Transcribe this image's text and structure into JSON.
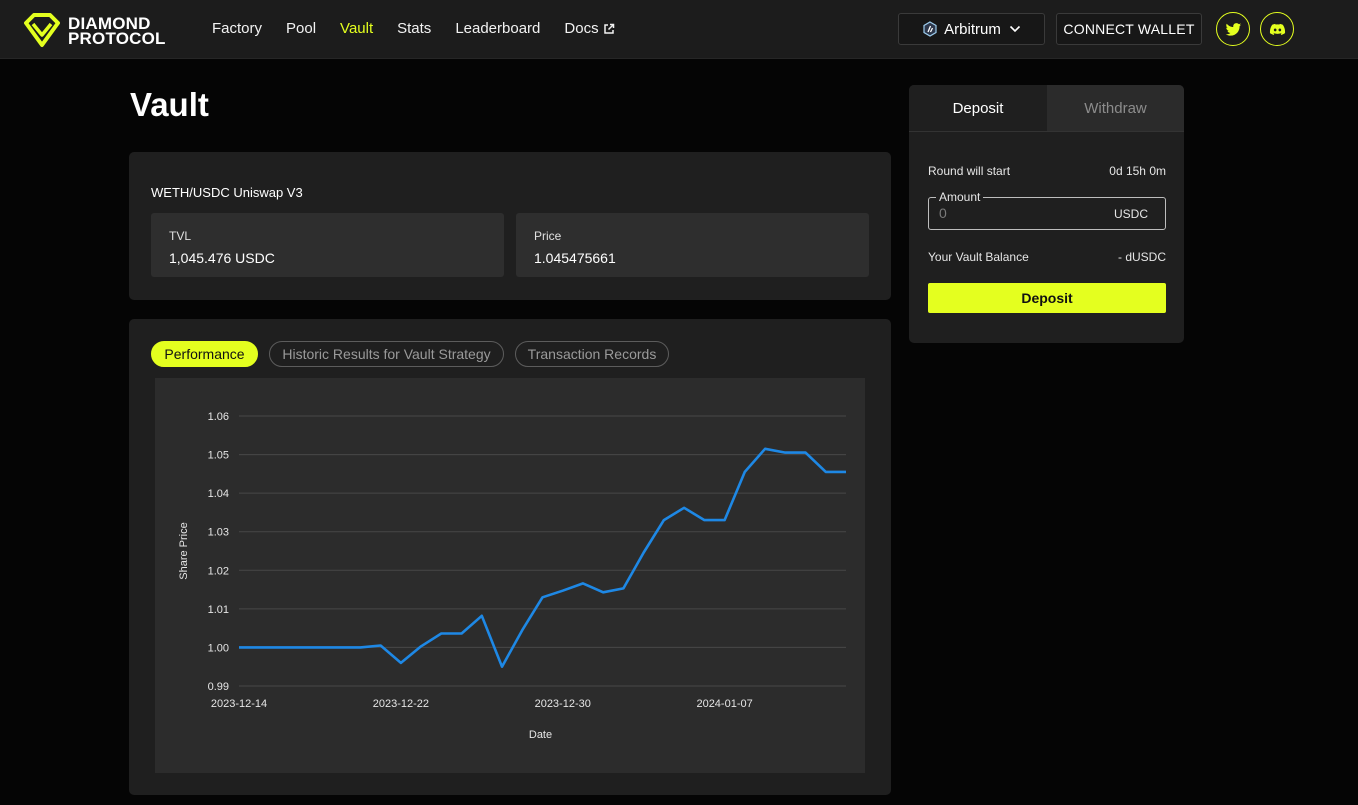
{
  "brand": {
    "line1": "DIAMOND",
    "line2": "PROTOCOL",
    "accent": "#e4ff1f"
  },
  "nav": {
    "links": [
      {
        "label": "Factory",
        "active": false
      },
      {
        "label": "Pool",
        "active": false
      },
      {
        "label": "Vault",
        "active": true
      },
      {
        "label": "Stats",
        "active": false
      },
      {
        "label": "Leaderboard",
        "active": false
      },
      {
        "label": "Docs",
        "active": false,
        "icon": "external-link-icon"
      }
    ],
    "network": "Arbitrum",
    "connect_label": "CONNECT WALLET",
    "socials": [
      "twitter-icon",
      "discord-icon"
    ]
  },
  "page": {
    "title": "Vault"
  },
  "vault": {
    "pair": "WETH/USDC Uniswap V3",
    "tvl_label": "TVL",
    "tvl_value": "1,045.476 USDC",
    "price_label": "Price",
    "price_value": "1.045475661"
  },
  "tabs": [
    {
      "label": "Performance",
      "active": true
    },
    {
      "label": "Historic Results for Vault Strategy",
      "active": false
    },
    {
      "label": "Transaction Records",
      "active": false
    }
  ],
  "side": {
    "tab_deposit": "Deposit",
    "tab_withdraw": "Withdraw",
    "round_label": "Round will start",
    "round_value": "0d 15h 0m",
    "amount_label": "Amount",
    "amount_placeholder": "0",
    "amount_unit": "USDC",
    "balance_label": "Your Vault Balance",
    "balance_value": "- dUSDC",
    "deposit_button": "Deposit"
  },
  "chart_data": {
    "type": "line",
    "xlabel": "Date",
    "ylabel": "Share Price",
    "ylim": [
      0.99,
      1.06
    ],
    "y_ticks": [
      "0.99",
      "1.00",
      "1.01",
      "1.02",
      "1.03",
      "1.04",
      "1.05",
      "1.06"
    ],
    "x_ticks": [
      "2023-12-14",
      "2023-12-22",
      "2023-12-30",
      "2024-01-07"
    ],
    "grid": true,
    "line_color": "#1e88e5",
    "series": [
      {
        "x": [
          "2023-12-14",
          "2023-12-15",
          "2023-12-16",
          "2023-12-17",
          "2023-12-18",
          "2023-12-19",
          "2023-12-20",
          "2023-12-21",
          "2023-12-22",
          "2023-12-23",
          "2023-12-24",
          "2023-12-25",
          "2023-12-26",
          "2023-12-27",
          "2023-12-28",
          "2023-12-29",
          "2023-12-30",
          "2023-12-31",
          "2024-01-01",
          "2024-01-02",
          "2024-01-03",
          "2024-01-04",
          "2024-01-05",
          "2024-01-06",
          "2024-01-07",
          "2024-01-08",
          "2024-01-09",
          "2024-01-10",
          "2024-01-11",
          "2024-01-12"
        ],
        "values": [
          1.0,
          1.0,
          1.0,
          1.0,
          1.0,
          1.0,
          1.0,
          1.0005,
          0.996,
          1.0003,
          1.0036,
          1.0036,
          1.0082,
          0.995,
          1.0045,
          1.013,
          1.0147,
          1.0166,
          1.0143,
          1.0153,
          1.0246,
          1.033,
          1.0362,
          1.033,
          1.033,
          1.0455,
          1.0515,
          1.0505,
          1.0505,
          1.0455
        ]
      },
      {
        "x": [
          "2024-01-13"
        ],
        "values": [
          1.0455
        ]
      }
    ]
  }
}
